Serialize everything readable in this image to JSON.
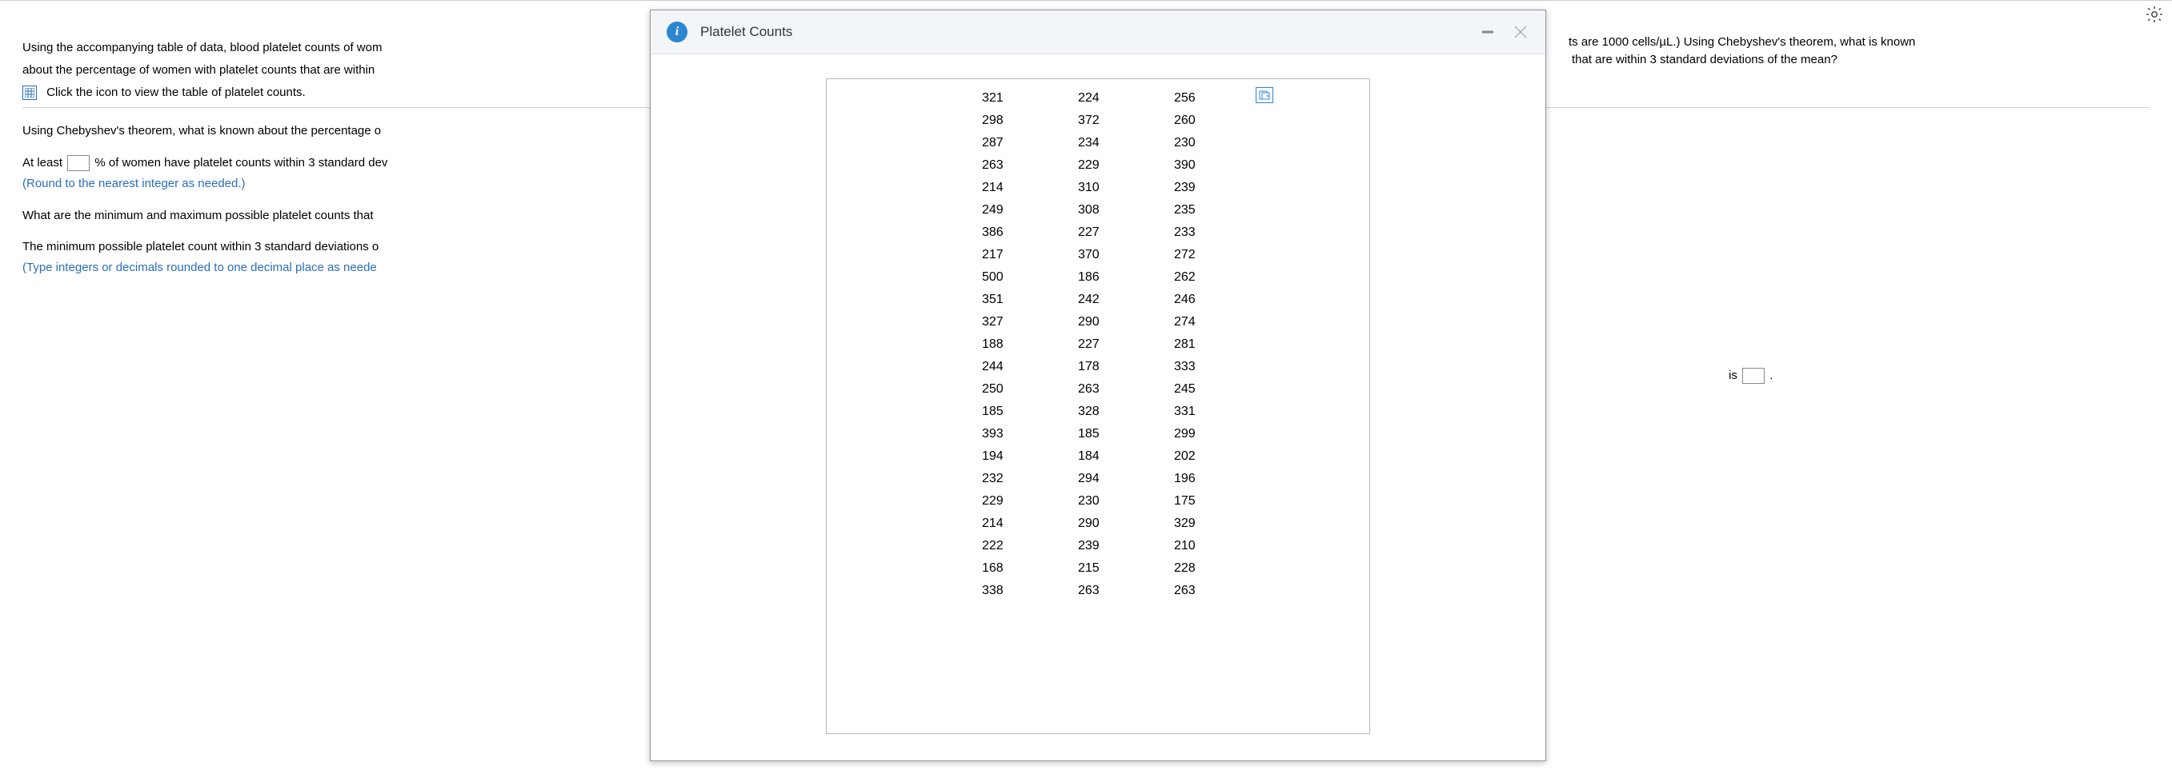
{
  "question": {
    "intro_left": "Using the accompanying table of data, blood platelet counts of wom",
    "intro_right": "ts are 1000 cells/µL.) Using Chebyshev's theorem, what is known",
    "line2_left": "about the percentage of women with platelet counts that are within",
    "line2_right": "that are within 3 standard deviations of the mean?",
    "link_text": "Click the icon to view the table of platelet counts.",
    "q1": "Using Chebyshev's theorem, what is known about the percentage o",
    "ans_prefix": "At least",
    "ans_suffix": "% of women have platelet counts within 3 standard dev",
    "hint1": "(Round to the nearest integer as needed.)",
    "q2": "What are the minimum and maximum possible platelet counts that",
    "ans2_prefix": "The minimum possible platelet count within 3 standard deviations o",
    "ans2_right": "is",
    "ans2_period": ".",
    "hint2": "(Type integers or decimals rounded to one decimal place as neede"
  },
  "modal": {
    "title": "Platelet Counts",
    "data": [
      [
        321,
        224,
        256
      ],
      [
        298,
        372,
        260
      ],
      [
        287,
        234,
        230
      ],
      [
        263,
        229,
        390
      ],
      [
        214,
        310,
        239
      ],
      [
        249,
        308,
        235
      ],
      [
        386,
        227,
        233
      ],
      [
        217,
        370,
        272
      ],
      [
        500,
        186,
        262
      ],
      [
        351,
        242,
        246
      ],
      [
        327,
        290,
        274
      ],
      [
        188,
        227,
        281
      ],
      [
        244,
        178,
        333
      ],
      [
        250,
        263,
        245
      ],
      [
        185,
        328,
        331
      ],
      [
        393,
        185,
        299
      ],
      [
        194,
        184,
        202
      ],
      [
        232,
        294,
        196
      ],
      [
        229,
        230,
        175
      ],
      [
        214,
        290,
        329
      ],
      [
        222,
        239,
        210
      ],
      [
        168,
        215,
        228
      ],
      [
        338,
        263,
        263
      ]
    ]
  }
}
